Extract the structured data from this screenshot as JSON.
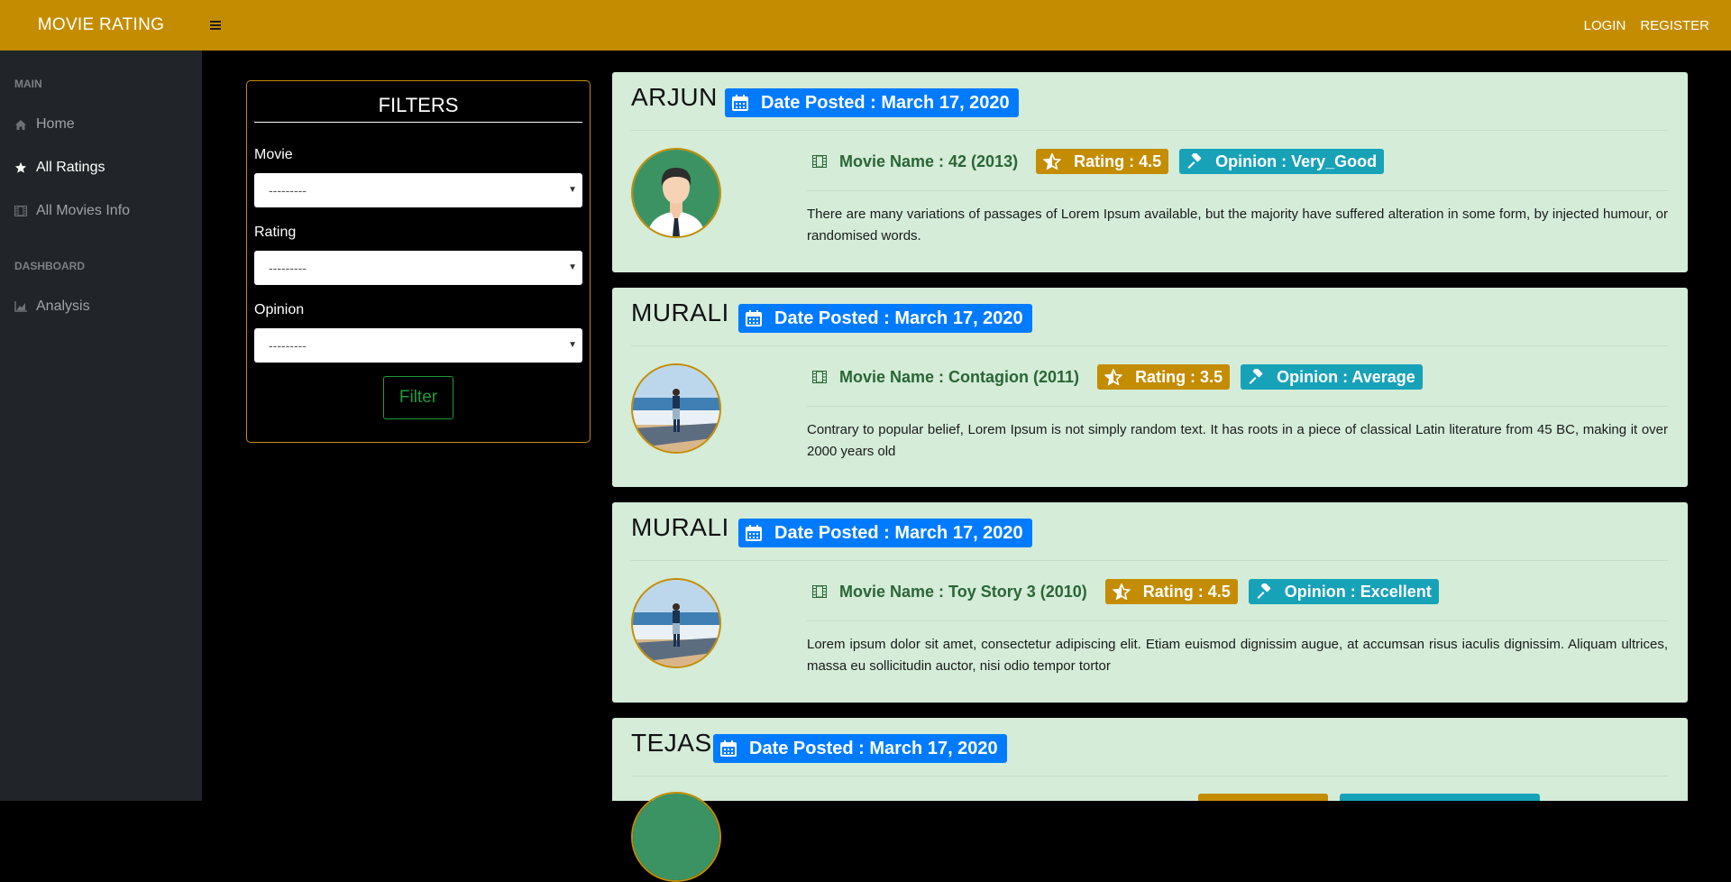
{
  "app": {
    "title": "MOVIE RATING"
  },
  "topnav": {
    "login": "LOGIN",
    "register": "REGISTER"
  },
  "sidebar": {
    "headings": [
      "MAIN",
      "DASHBOARD"
    ],
    "items": [
      {
        "label": "Home",
        "icon": "home-icon"
      },
      {
        "label": "All Ratings",
        "icon": "star-icon",
        "active": true
      },
      {
        "label": "All Movies Info",
        "icon": "film-icon"
      },
      {
        "label": "Analysis",
        "icon": "chart-icon"
      }
    ]
  },
  "filters": {
    "title": "FILTERS",
    "movie_label": "Movie",
    "movie_value": "---------",
    "rating_label": "Rating",
    "rating_value": "---------",
    "opinion_label": "Opinion",
    "opinion_value": "---------",
    "button": "Filter"
  },
  "colors": {
    "accent": "#c48c00",
    "date_badge": "#007bff",
    "opinion_badge": "#17a2b8",
    "card_bg": "#d4ecd8",
    "movie_text": "#2a6637"
  },
  "reviews": [
    {
      "user": "ARJUN",
      "date": "Date Posted : March 17, 2020",
      "movie": "Movie Name : 42 (2013)",
      "rating": "Rating : 4.5",
      "opinion": "Opinion : Very_Good",
      "text": "There are many variations of passages of Lorem Ipsum available, but the majority have suffered alteration in some form, by injected humour, or randomised words.",
      "avatar": "man-avatar-icon"
    },
    {
      "user": "MURALI",
      "date": "Date Posted : March 17, 2020",
      "movie": "Movie Name : Contagion (2011)",
      "rating": "Rating : 3.5",
      "opinion": "Opinion : Average",
      "text": "Contrary to popular belief, Lorem Ipsum is not simply random text. It has roots in a piece of classical Latin literature from 45 BC, making it over 2000 years old",
      "avatar": "beach-photo-avatar"
    },
    {
      "user": "MURALI",
      "date": "Date Posted : March 17, 2020",
      "movie": "Movie Name : Toy Story 3 (2010)",
      "rating": "Rating : 4.5",
      "opinion": "Opinion : Excellent",
      "text": "Lorem ipsum dolor sit amet, consectetur adipiscing elit. Etiam euismod dignissim augue, at accumsan risus iaculis dignissim. Aliquam ultrices, massa eu sollicitudin auctor, nisi odio tempor tortor",
      "avatar": "beach-photo-avatar"
    },
    {
      "user": "TEJAS",
      "date": "Date Posted : March 17, 2020"
    }
  ]
}
